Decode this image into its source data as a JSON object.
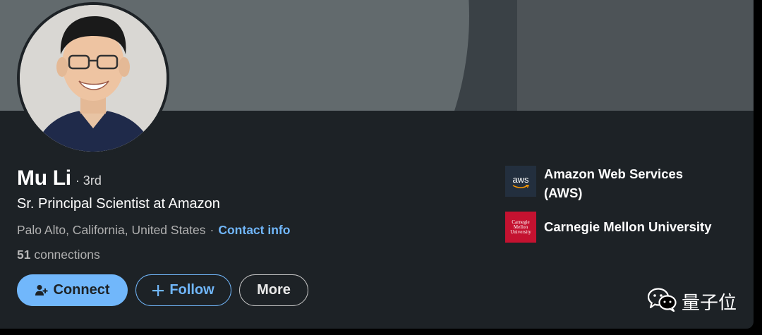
{
  "profile": {
    "name": "Mu Li",
    "degree": "· 3rd",
    "headline": "Sr. Principal Scientist at Amazon",
    "location": "Palo Alto, California, United States",
    "separator": "·",
    "contact_label": "Contact info",
    "connections_count": "51",
    "connections_label": "connections"
  },
  "actions": {
    "connect_label": "Connect",
    "follow_label": "Follow",
    "more_label": "More"
  },
  "organizations": [
    {
      "logo_text": "aws",
      "name_line1": "Amazon Web Services",
      "name_line2": "(AWS)"
    },
    {
      "logo_text": "Carnegie Mellon University",
      "name_line1": "Carnegie Mellon University"
    }
  ],
  "watermark": {
    "text": "量子位",
    "icon": "wechat-icon"
  },
  "colors": {
    "accent": "#71b7fb",
    "card_bg": "#1d2226",
    "aws_bg": "#232f3e",
    "cmu_red": "#c41230"
  }
}
